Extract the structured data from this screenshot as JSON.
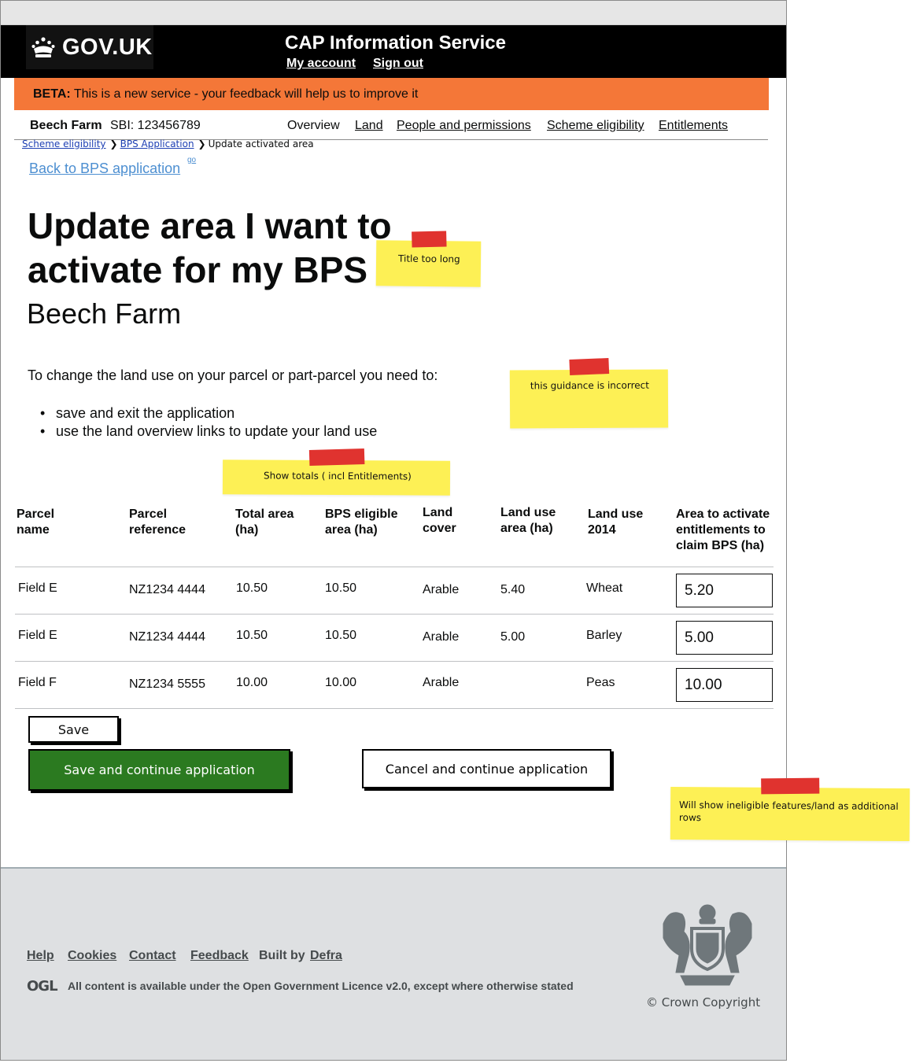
{
  "header": {
    "logo_text": "GOV.UK",
    "service_name": "CAP Information Service",
    "my_account": "My account",
    "sign_out": "Sign out"
  },
  "beta": {
    "tag": "BETA:",
    "message": "This is a new service - your feedback will help us to improve it"
  },
  "farm_bar": {
    "farm_name": "Beech Farm",
    "sbi": "SBI: 123456789",
    "nav": [
      "Overview",
      "Land",
      "People and permissions",
      "Scheme eligibility",
      "Entitlements"
    ]
  },
  "breadcrumb": {
    "items": [
      "Scheme eligibility",
      "BPS Application"
    ],
    "current": "Update activated area"
  },
  "back_link": "Back to BPS application",
  "back_link_go": "go",
  "title": "Update area I want to activate for my BPS",
  "subtitle": "Beech Farm",
  "intro": "To change the land use on your parcel or part-parcel you need to:",
  "bullets": [
    "save and exit the application",
    "use the land overview links to update your land use"
  ],
  "notes": {
    "title": "Title too long",
    "guidance": "this guidance is incorrect",
    "totals": "Show totals ( incl Entitlements)",
    "ineligible": "Will show ineligible features/land as additional rows"
  },
  "table": {
    "headers": [
      [
        "Parcel",
        "name"
      ],
      [
        "Parcel",
        "reference"
      ],
      [
        "Total area",
        "(ha)"
      ],
      [
        "BPS eligible",
        "area (ha)"
      ],
      [
        "Land",
        "cover"
      ],
      [
        "Land use",
        "area (ha)"
      ],
      [
        "Land use",
        "2014"
      ],
      [
        "Area to activate",
        "entitlements to",
        "claim BPS (ha)"
      ]
    ],
    "rows": [
      {
        "name": "Field E",
        "ref": "NZ1234 4444",
        "total": "10.50",
        "bps": "10.50",
        "cover": "Arable",
        "use_area": "5.40",
        "use_2014": "Wheat",
        "activate": "5.20"
      },
      {
        "name": "Field E",
        "ref": "NZ1234 4444",
        "total": "10.50",
        "bps": "10.50",
        "cover": "Arable",
        "use_area": "5.00",
        "use_2014": "Barley",
        "activate": "5.00"
      },
      {
        "name": "Field F",
        "ref": "NZ1234 5555",
        "total": "10.00",
        "bps": "10.00",
        "cover": "Arable",
        "use_area": "",
        "use_2014": "Peas",
        "activate": "10.00"
      }
    ]
  },
  "buttons": {
    "save": "Save",
    "save_continue": "Save and continue application",
    "cancel_continue": "Cancel and continue application"
  },
  "footer": {
    "links": [
      "Help",
      "Cookies",
      "Contact",
      "Feedback"
    ],
    "built_by": "Built by",
    "defra": "Defra",
    "ogl": "OGL",
    "licence": "All content is available under the Open Government Licence v2.0, except where otherwise stated",
    "copyright": "© Crown Copyright"
  },
  "colors": {
    "header_bg": "#000000",
    "beta_bg": "#f47738",
    "sticky_note": "#fdf055",
    "tape": "#e0332f",
    "primary_button": "#2b7a20",
    "footer_bg": "#dee0e2",
    "link": "#4d8fd1"
  }
}
